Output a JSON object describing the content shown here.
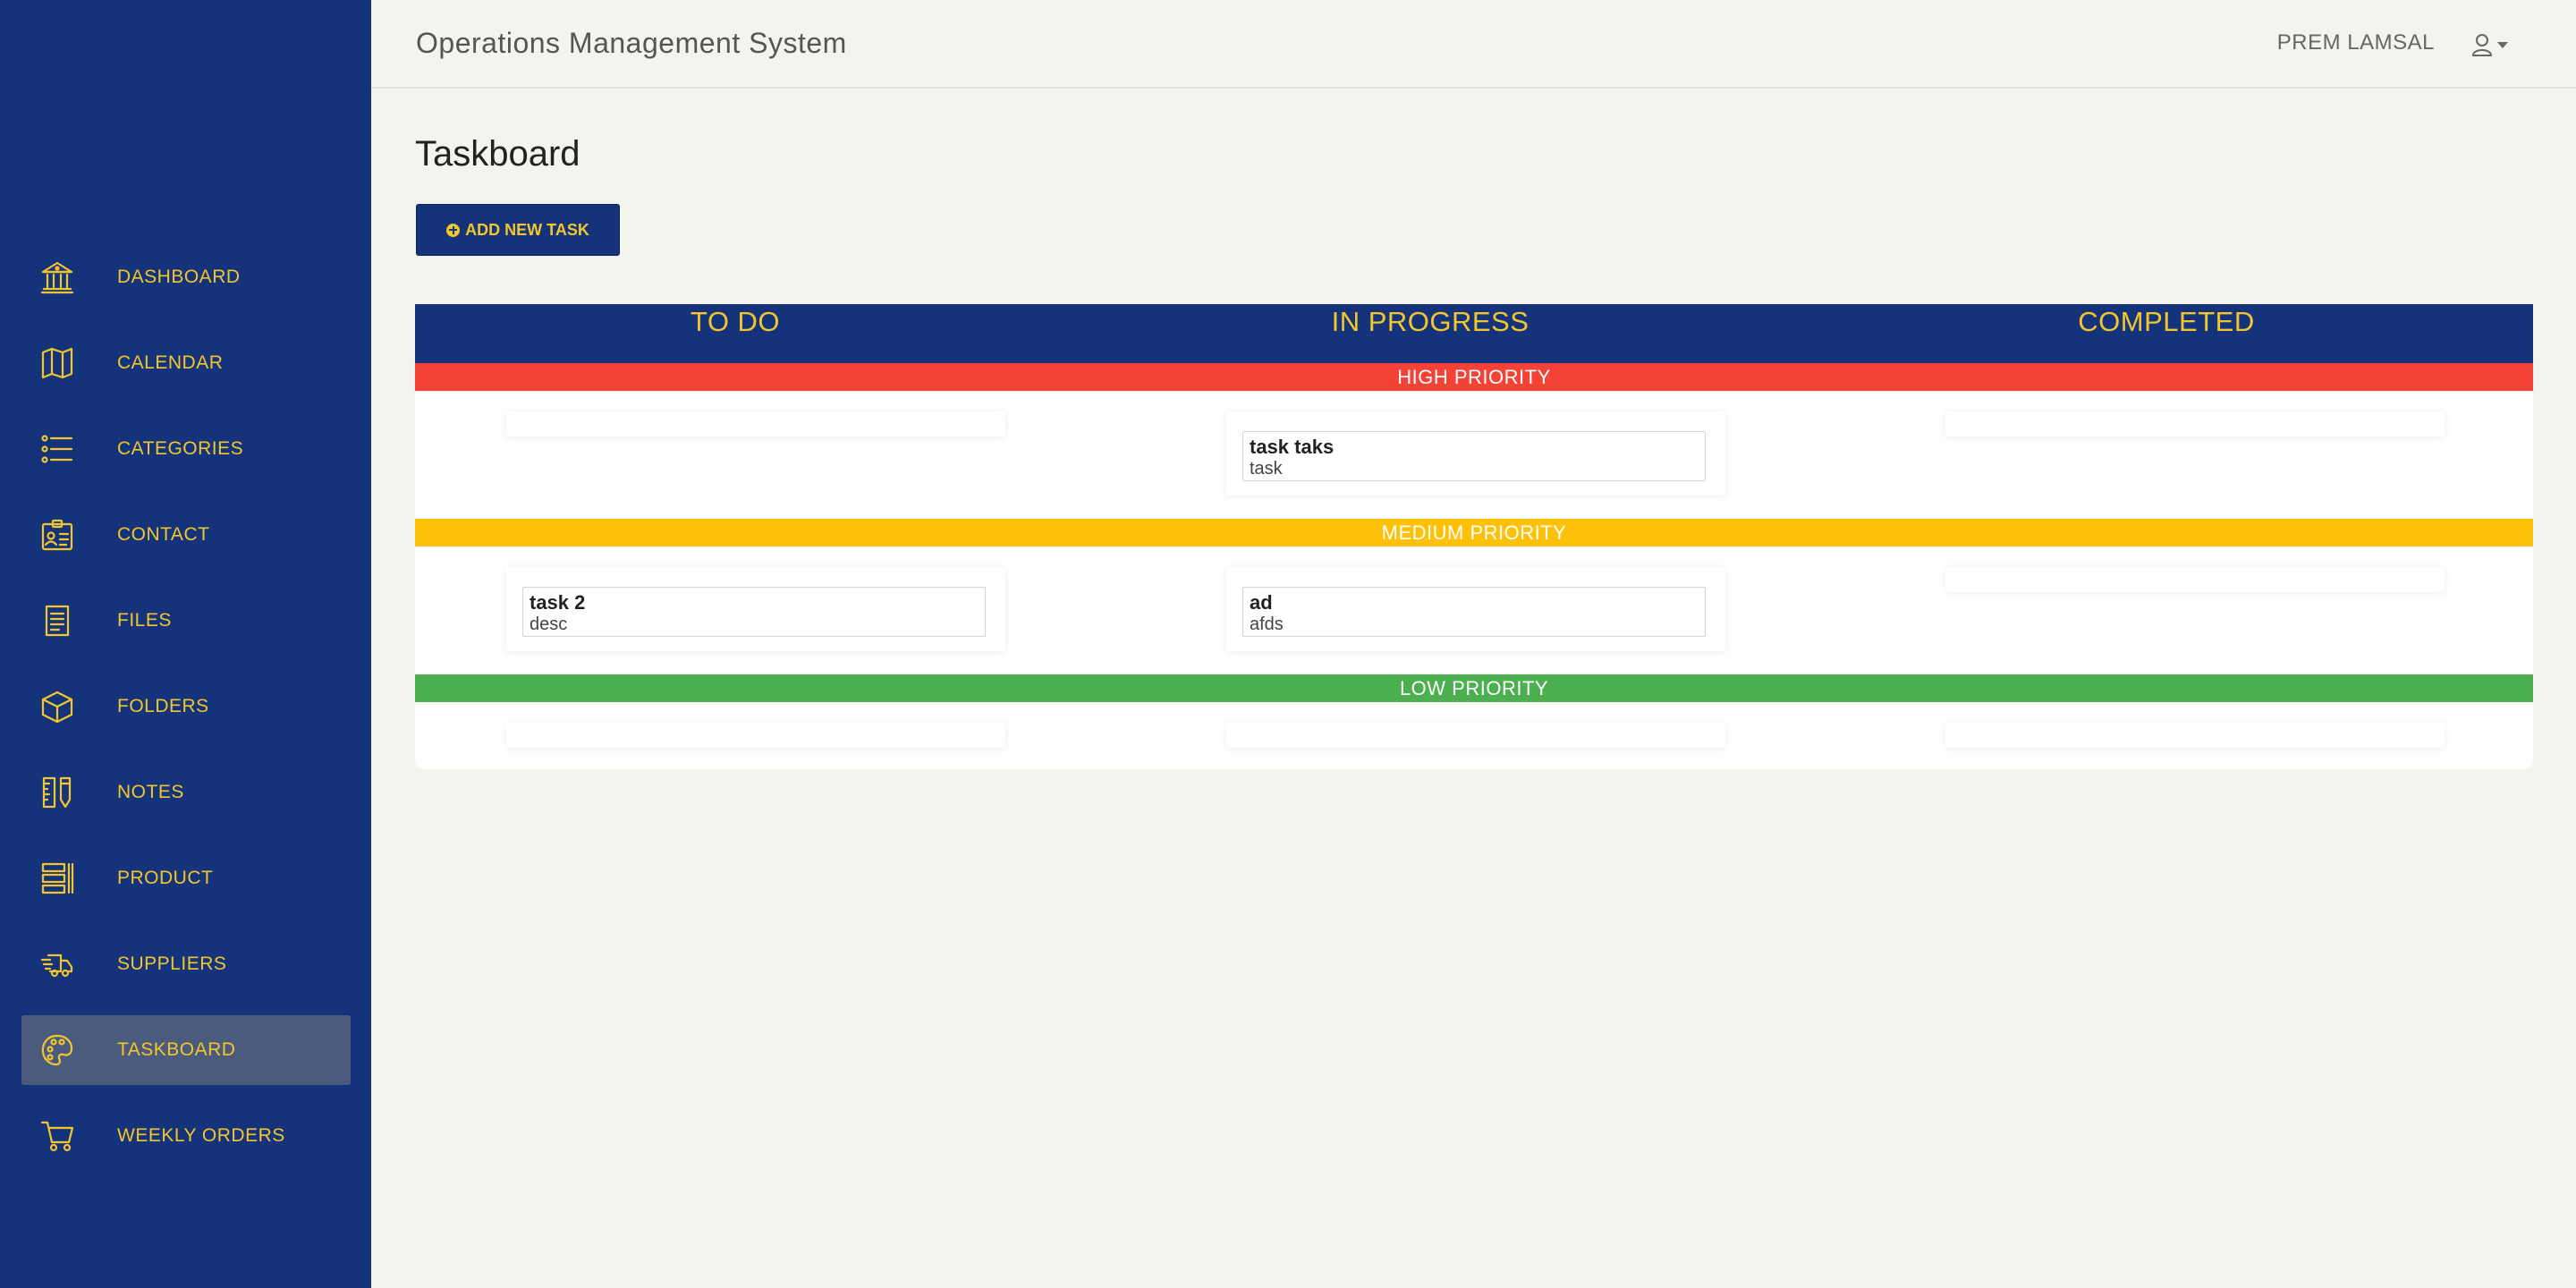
{
  "app": {
    "title": "Operations Management System"
  },
  "user": {
    "name": "PREM LAMSAL"
  },
  "colors": {
    "sidebar": "#15337a",
    "accent": "#f2c62d",
    "high": "#f44336",
    "medium": "#ffc107",
    "low": "#4caf50",
    "active_item": "#4a5b7e"
  },
  "sidebar": {
    "items": [
      {
        "label": "DASHBOARD",
        "icon": "bank-icon"
      },
      {
        "label": "CALENDAR",
        "icon": "map-icon"
      },
      {
        "label": "CATEGORIES",
        "icon": "list-icon"
      },
      {
        "label": "CONTACT",
        "icon": "id-badge-icon"
      },
      {
        "label": "FILES",
        "icon": "document-icon"
      },
      {
        "label": "FOLDERS",
        "icon": "box-icon"
      },
      {
        "label": "NOTES",
        "icon": "ruler-pencil-icon"
      },
      {
        "label": "PRODUCT",
        "icon": "product-list-icon"
      },
      {
        "label": "SUPPLIERS",
        "icon": "delivery-truck-icon"
      },
      {
        "label": "TASKBOARD",
        "icon": "palette-icon",
        "active": true
      },
      {
        "label": "WEEKLY ORDERS",
        "icon": "cart-icon"
      }
    ]
  },
  "page": {
    "title": "Taskboard",
    "add_button": "ADD NEW TASK"
  },
  "board": {
    "columns": [
      "TO DO",
      "IN PROGRESS",
      "COMPLETED"
    ],
    "priorities": [
      "HIGH PRIORITY",
      "MEDIUM PRIORITY",
      "LOW PRIORITY"
    ],
    "tasks": {
      "high_in_progress": {
        "title": "task taks",
        "desc": "task"
      },
      "medium_todo": {
        "title": "task 2",
        "desc": "desc"
      },
      "medium_in_progress": {
        "title": "ad",
        "desc": "afds"
      }
    }
  }
}
